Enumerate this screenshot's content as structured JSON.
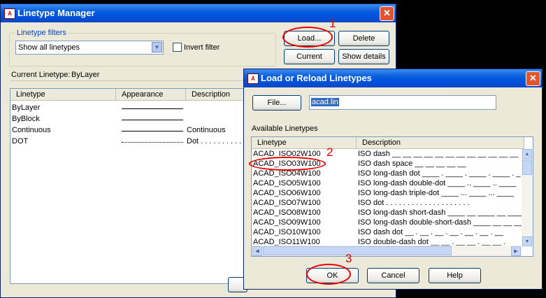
{
  "manager": {
    "title": "Linetype Manager",
    "filters_label": "Linetype filters",
    "filter_value": "Show all linetypes",
    "invert_label": "Invert filter",
    "buttons": {
      "load": "Load...",
      "delete": "Delete",
      "current": "Current",
      "show_details": "Show details"
    },
    "current_label": "Current Linetype:",
    "current_value": "ByLayer",
    "columns": [
      "Linetype",
      "Appearance",
      "Description"
    ],
    "rows": [
      {
        "name": "ByLayer",
        "desc": ""
      },
      {
        "name": "ByBlock",
        "desc": ""
      },
      {
        "name": "Continuous",
        "desc": "Continuous"
      },
      {
        "name": "DOT",
        "desc": "Dot . . . . . . . . . ."
      }
    ]
  },
  "dialog": {
    "title": "Load or Reload Linetypes",
    "file_button": "File...",
    "file_value": "acad.lin",
    "available_label": "Available Linetypes",
    "columns": [
      "Linetype",
      "Description"
    ],
    "rows": [
      {
        "name": "ACAD_ISO02W100",
        "desc": "ISO dash __ __ __ __ __ __ __ __ __ __ __ __"
      },
      {
        "name": "ACAD_ISO03W100",
        "desc": "ISO dash space __    __    __    __    __"
      },
      {
        "name": "ACAD_ISO04W100",
        "desc": "ISO long-dash dot ____ . ____ . ____ . ____ . _"
      },
      {
        "name": "ACAD_ISO05W100",
        "desc": "ISO long-dash double-dot ____ .. ____ .. ____"
      },
      {
        "name": "ACAD_ISO06W100",
        "desc": "ISO long-dash triple-dot ____ ... ____ ... ____"
      },
      {
        "name": "ACAD_ISO07W100",
        "desc": "ISO dot . . . . . . . . . . . . . . . . . . . ."
      },
      {
        "name": "ACAD_ISO08W100",
        "desc": "ISO long-dash short-dash ____ __ ____ __ ____"
      },
      {
        "name": "ACAD_ISO09W100",
        "desc": "ISO long-dash double-short-dash ____ __ __ ____"
      },
      {
        "name": "ACAD_ISO10W100",
        "desc": "ISO dash dot __ . __ . __ . __ . __ . __ . __"
      },
      {
        "name": "ACAD_ISO11W100",
        "desc": "ISO double-dash dot __ __ . __ __ . __ __ ."
      }
    ],
    "ok": "OK",
    "cancel": "Cancel",
    "help": "Help"
  },
  "annotations": {
    "step1": "1",
    "step2": "2",
    "step3": "3"
  },
  "colors": {
    "titlebar": "#0054e3",
    "annotation": "#e00000"
  }
}
